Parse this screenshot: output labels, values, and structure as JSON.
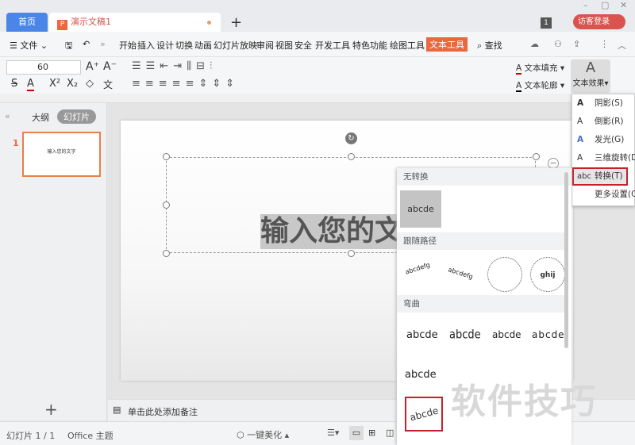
{
  "tabs": {
    "home": "首页",
    "doc": "演示文稿1",
    "new": "+"
  },
  "window": {
    "badge": "1",
    "login": "访客登录",
    "min": "–",
    "max": "▢",
    "close": "✕"
  },
  "menu": {
    "file": "文件",
    "items": [
      "开始",
      "插入",
      "设计",
      "切换",
      "动画",
      "幻灯片放映",
      "审阅",
      "视图",
      "安全",
      "开发工具",
      "特色功能",
      "绘图工具"
    ],
    "active": "文本工具",
    "search": "查找"
  },
  "ribbon": {
    "font_size": "60",
    "text_fill": "文本填充",
    "text_outline": "文本轮廓",
    "text_effect": "文本效果",
    "style_letter": "A"
  },
  "style_colors": [
    "#000000",
    "#4a86d8",
    "#5bc0e8",
    "#f0c0b8",
    "#f0b040",
    "#777777"
  ],
  "left_panel": {
    "outline": "大纲",
    "slides": "幻灯片",
    "slide_num": "1",
    "thumb_text": "输入您的文字",
    "add": "+"
  },
  "slide": {
    "text": "输入您的文"
  },
  "notes": {
    "placeholder": "单击此处添加备注"
  },
  "status": {
    "slide": "幻灯片 1 / 1",
    "theme": "Office 主题",
    "beautify": "一键美化"
  },
  "effects_menu": [
    {
      "icon": "A",
      "label": "阴影(S)"
    },
    {
      "icon": "A",
      "label": "倒影(R)"
    },
    {
      "icon": "A",
      "label": "发光(G)"
    },
    {
      "icon": "A",
      "label": "三维旋转(D)"
    },
    {
      "icon": "abc",
      "label": "转换(T)"
    },
    {
      "icon": "",
      "label": "更多设置(C)"
    }
  ],
  "transform_panel": {
    "none": "无转换",
    "follow_path": "跟随路径",
    "warp": "弯曲",
    "sample": "abcde",
    "path_samples": [
      "abcdefg",
      "abcdefg",
      "abcdefghijk",
      "abcdefghijk"
    ]
  },
  "watermark": "软件技巧",
  "accent": "#e8693c"
}
